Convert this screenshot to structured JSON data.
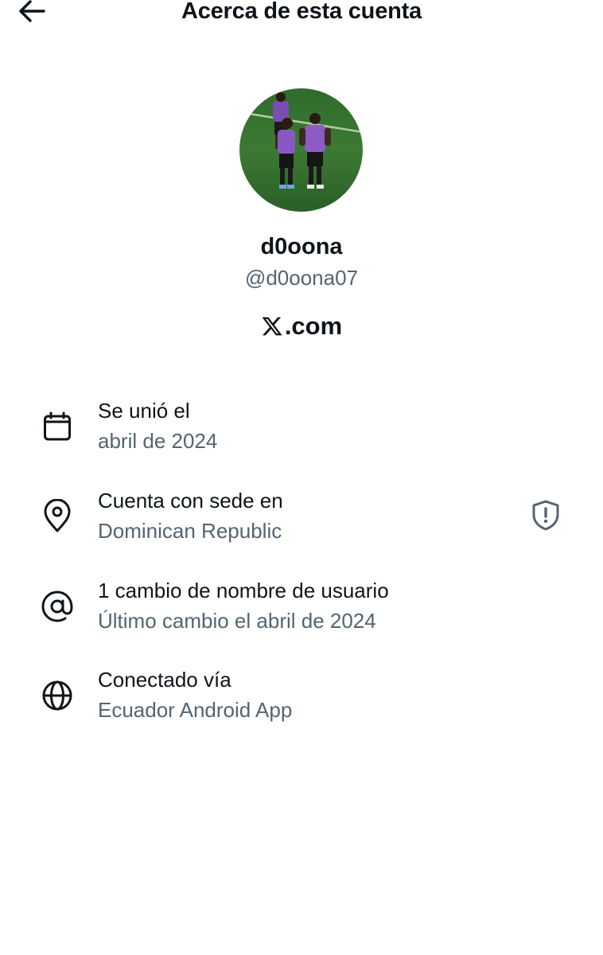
{
  "header": {
    "title": "Acerca de esta cuenta",
    "back_icon": "arrow-left-icon"
  },
  "profile": {
    "display_name": "d0oona",
    "handle": "@d0oona07",
    "avatar_alt": "profile photo"
  },
  "brand": {
    "logo_icon": "x-logo-icon",
    "domain": ".com"
  },
  "details": [
    {
      "icon": "calendar-icon",
      "label": "Se unió el",
      "value": "abril de 2024"
    },
    {
      "icon": "location-pin-icon",
      "label": "Cuenta con sede en",
      "value": "Dominican Republic",
      "action_icon": "shield-alert-icon"
    },
    {
      "icon": "at-sign-icon",
      "label": "1 cambio de nombre de usuario",
      "value": "Último cambio el abril de 2024"
    },
    {
      "icon": "globe-icon",
      "label": "Conectado vía",
      "value": "Ecuador Android App"
    }
  ],
  "colors": {
    "primary_text": "#0f1419",
    "secondary_text": "#536471"
  }
}
